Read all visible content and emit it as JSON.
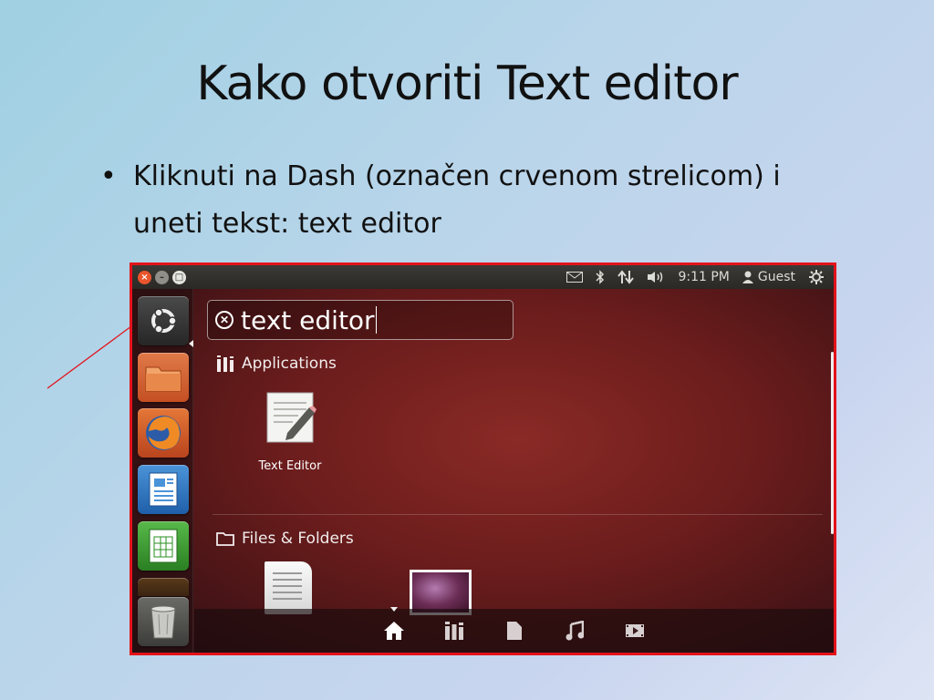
{
  "slide": {
    "title": "Kako otvoriti Text editor",
    "bullet": "Kliknuti na Dash (označen crvenom strelicom) i uneti tekst: text editor"
  },
  "window_buttons": {
    "close": "×",
    "minimize": "–",
    "maximize": "□"
  },
  "topbar": {
    "icons": [
      "mail-icon",
      "bluetooth-icon",
      "network-icon",
      "volume-icon",
      "session-gear-icon"
    ],
    "time": "9:11 PM",
    "user": "Guest"
  },
  "launcher": {
    "items": [
      "dash-home",
      "files",
      "firefox",
      "libreoffice-writer",
      "libreoffice-calc",
      "trash"
    ]
  },
  "search": {
    "value": "text editor"
  },
  "sections": {
    "applications": "Applications",
    "files_folders": "Files & Folders"
  },
  "results": {
    "apps": [
      {
        "label": "Text Editor",
        "icon": "text-editor-icon"
      }
    ]
  },
  "filters": [
    "home-lens-icon",
    "applications-lens-icon",
    "files-lens-icon",
    "music-lens-icon",
    "video-lens-icon"
  ],
  "colors": {
    "frame": "#e3131b",
    "arrow": "#e3131b",
    "dash_bg": "#6a1c1c"
  }
}
